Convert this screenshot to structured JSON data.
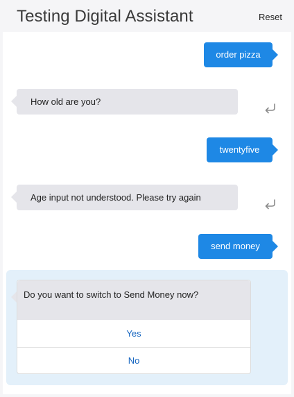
{
  "header": {
    "title": "Testing Digital Assistant",
    "reset_label": "Reset"
  },
  "messages": {
    "m1": "order pizza",
    "m2": "How old are you?",
    "m3": "twentyfive",
    "m4": "Age input not understood. Please try again",
    "m5": "send money"
  },
  "card": {
    "question": "Do you want to switch to Send Money now?",
    "options": [
      "Yes",
      "No"
    ]
  },
  "colors": {
    "user_bubble": "#1e88e5",
    "bot_bubble": "#e5e5ea",
    "card_background": "#e3f0fa",
    "option_text": "#1565c0"
  },
  "icons": {
    "reply": "reply-arrow-icon"
  }
}
